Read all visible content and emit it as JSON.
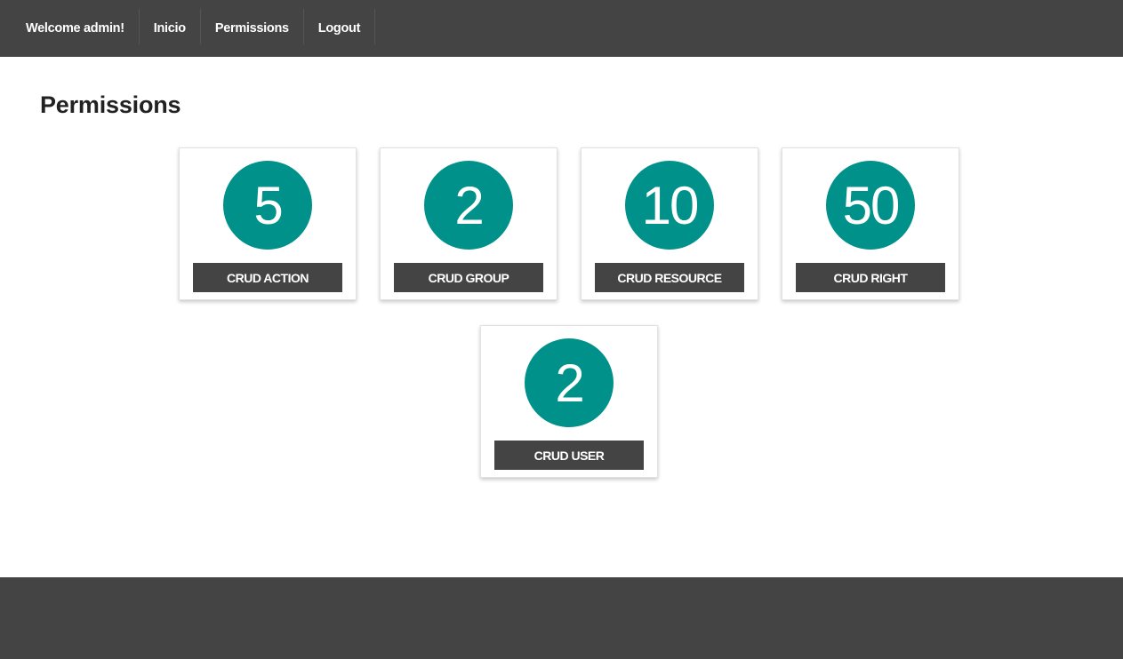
{
  "nav": {
    "welcome": "Welcome admin!",
    "items": [
      {
        "label": "Inicio"
      },
      {
        "label": "Permissions"
      },
      {
        "label": "Logout"
      }
    ]
  },
  "page": {
    "title": "Permissions"
  },
  "cards": [
    {
      "count": "5",
      "label": "CRUD ACTION"
    },
    {
      "count": "2",
      "label": "CRUD GROUP"
    },
    {
      "count": "10",
      "label": "CRUD RESOURCE"
    },
    {
      "count": "50",
      "label": "CRUD RIGHT"
    },
    {
      "count": "2",
      "label": "CRUD USER"
    }
  ],
  "colors": {
    "header": "#444444",
    "accent": "#00928a",
    "footer": "#444444"
  }
}
